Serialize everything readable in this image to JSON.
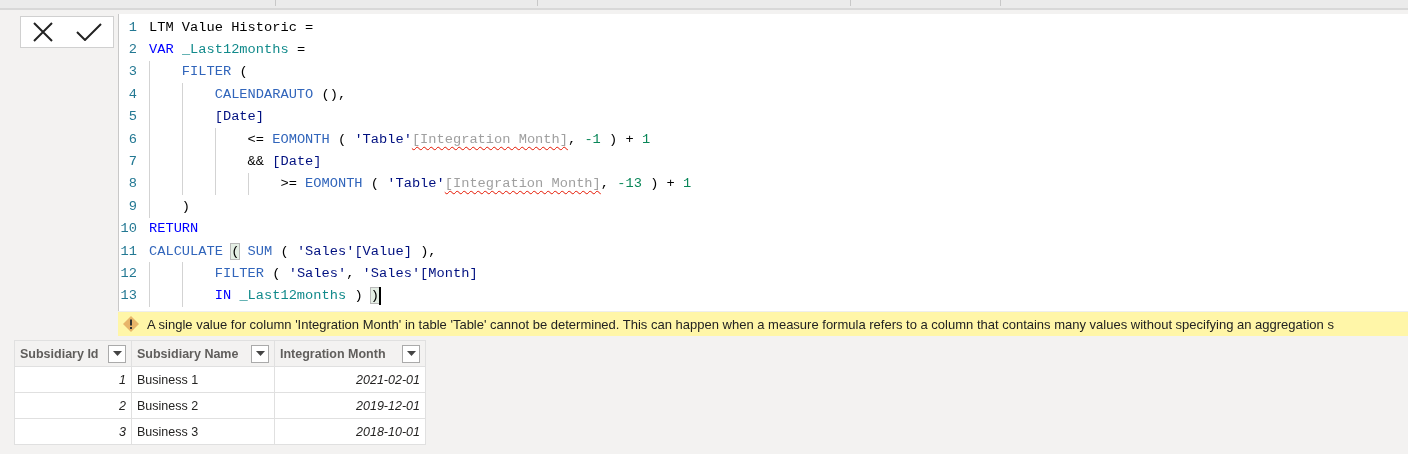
{
  "formula_bar": {
    "lines": [
      {
        "number": "1",
        "text": [
          {
            "kind": "plain",
            "t": "LTM Value Historic ="
          }
        ]
      },
      {
        "number": "2",
        "text": [
          {
            "kind": "keyword",
            "t": "VAR"
          },
          {
            "kind": "variable",
            "t": " _Last12months"
          },
          {
            "kind": "plain",
            "t": " ="
          }
        ]
      },
      {
        "number": "3",
        "text": [
          {
            "kind": "function",
            "t": "    FILTER"
          },
          {
            "kind": "plain",
            "t": " ("
          }
        ]
      },
      {
        "number": "4",
        "text": [
          {
            "kind": "function",
            "t": "        CALENDARAUTO"
          },
          {
            "kind": "plain",
            "t": " (),"
          }
        ]
      },
      {
        "number": "5",
        "text": [
          {
            "kind": "reference",
            "t": "        [Date]"
          }
        ]
      },
      {
        "number": "6",
        "text": [
          {
            "kind": "plain",
            "t": "            <= "
          },
          {
            "kind": "function",
            "t": "EOMONTH"
          },
          {
            "kind": "plain",
            "t": " ( "
          },
          {
            "kind": "reference",
            "t": "'Table'"
          },
          {
            "kind": "error",
            "t": "[Integration Month]"
          },
          {
            "kind": "plain",
            "t": ", "
          },
          {
            "kind": "number",
            "t": "-1"
          },
          {
            "kind": "plain",
            "t": " ) + "
          },
          {
            "kind": "number",
            "t": "1"
          }
        ]
      },
      {
        "number": "7",
        "text": [
          {
            "kind": "plain",
            "t": "            && "
          },
          {
            "kind": "reference",
            "t": "[Date]"
          }
        ]
      },
      {
        "number": "8",
        "text": [
          {
            "kind": "plain",
            "t": "                >= "
          },
          {
            "kind": "function",
            "t": "EOMONTH"
          },
          {
            "kind": "plain",
            "t": " ( "
          },
          {
            "kind": "reference",
            "t": "'Table'"
          },
          {
            "kind": "error",
            "t": "[Integration Month]"
          },
          {
            "kind": "plain",
            "t": ", "
          },
          {
            "kind": "number",
            "t": "-13"
          },
          {
            "kind": "plain",
            "t": " ) + "
          },
          {
            "kind": "number",
            "t": "1"
          }
        ]
      },
      {
        "number": "9",
        "text": [
          {
            "kind": "plain",
            "t": "    )"
          }
        ]
      },
      {
        "number": "10",
        "text": [
          {
            "kind": "keyword",
            "t": "RETURN"
          }
        ]
      },
      {
        "number": "11",
        "text": [
          {
            "kind": "function",
            "t": "CALCULATE"
          },
          {
            "kind": "bracket",
            "t": " ("
          },
          {
            "kind": "function",
            "t": " SUM"
          },
          {
            "kind": "plain",
            "t": " ( "
          },
          {
            "kind": "reference",
            "t": "'Sales'[Value]"
          },
          {
            "kind": "plain",
            "t": " ),"
          }
        ]
      },
      {
        "number": "12",
        "text": [
          {
            "kind": "function",
            "t": "        FILTER"
          },
          {
            "kind": "plain",
            "t": " ( "
          },
          {
            "kind": "reference",
            "t": "'Sales'"
          },
          {
            "kind": "plain",
            "t": ", "
          },
          {
            "kind": "reference",
            "t": "'Sales'[Month]"
          }
        ]
      },
      {
        "number": "13",
        "cursor": true,
        "text": [
          {
            "kind": "keyword",
            "t": "        IN"
          },
          {
            "kind": "variable",
            "t": " _Last12months"
          },
          {
            "kind": "plain",
            "t": " ) "
          },
          {
            "kind": "bracket",
            "t": ")"
          }
        ]
      }
    ],
    "warning": "A single value for column 'Integration Month' in table 'Table' cannot be determined. This can happen when a measure formula refers to a column that contains many values without specifying an aggregation s"
  },
  "table": {
    "columns": [
      "Subsidiary Id",
      "Subsidiary Name",
      "Integration Month"
    ],
    "rows": [
      [
        "1",
        "Business 1",
        "2021-02-01"
      ],
      [
        "2",
        "Business 2",
        "2019-12-01"
      ],
      [
        "3",
        "Business 3",
        "2018-10-01"
      ]
    ]
  }
}
